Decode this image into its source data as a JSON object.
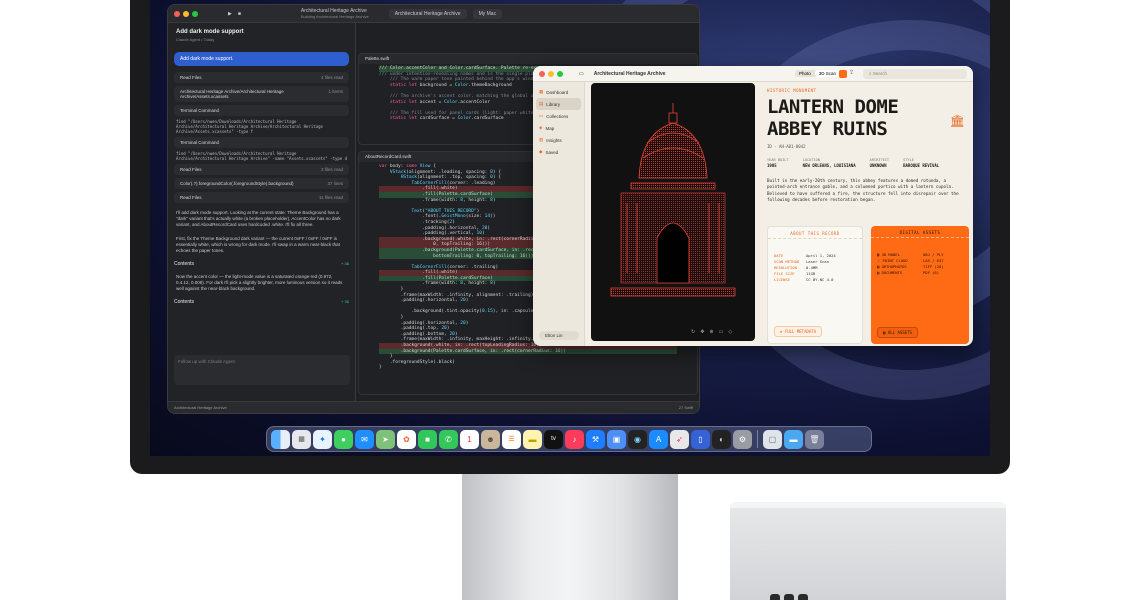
{
  "xcode": {
    "project": "Architectural Heritage Archive",
    "project_status": "Building Architectural Heritage Archive",
    "tab_file": "Architectural Heritage Archive",
    "tab_device": "My Mac",
    "chat_title": "Add dark mode support",
    "chat_sub": "Claude Agent • Today",
    "user_message": "Add dark mode support.",
    "cards": [
      {
        "label": "Read Files",
        "right": "4 files read"
      },
      {
        "label": "Architectural Heritage Archive/Architectural Heritage Archive/Assets.xcassets",
        "right": "1 items"
      },
      {
        "label": "Terminal Command",
        "right": ""
      },
      {
        "label": "Terminal Command",
        "right": ""
      },
      {
        "label": "Read Files",
        "right": "3 files read"
      },
      {
        "label": "Color(.?).foregroundColor(.foregroundStyle(.background)",
        "right": "37 lines"
      },
      {
        "label": "Read Files",
        "right": "11 files read"
      }
    ],
    "cmd1": "find \"/Users/nwen/Downloads/Architectural Heritage Archive/Architectural Heritage Archive/Architectural Heritage Archive/Assets.xcassets\" -type f",
    "cmd2": "find \"/Users/nwen/Downloads/Architectural Heritage Archive/Architectural Heritage Archive\" -name \"Assets.xcassets\" -type d",
    "cmd3": "find \"/Users/nwen/Downloads/Architectural Heritage Archive/Architectural Heritage Archive/Assets.xcassets\" -type f | head -20",
    "para1": "I'll add dark mode support. Looking at the current state: Theme Background has a \"dark\" variant that's actually white (a broken placeholder), AccentColor has no dark variant, and AboutRecordCard uses hardcoded .white. I'll fix all three.",
    "para2": "First, fix the Theme Background dark variant — the current 0xFF / 0xFF / 0xFF is essentially white, which is wrong for dark mode. I'll swap in a warm near-black that echoes the paper tones.",
    "chip1": "Contents",
    "chip1_tag": "+ 36",
    "para3": "Now the accent color — the light-mode value is a saturated orange-red (0.972, 0.4.12, 0.008). For dark I'll pick a slightly brighter, more luminous version so it reads well against the near-black background.",
    "chip2": "Contents",
    "chip2_tag": "+ 36",
    "input_placeholder": "Follow up with Claude Agent",
    "file1": "Palette.swift",
    "file2": "AboutRecordCard.swift",
    "status": "Architectural Heritage Archive",
    "status_right": "27 Swift"
  },
  "archive": {
    "window_title": "Architectural Heritage Archive",
    "seg_photo": "Photo",
    "seg_scan": "3D Scan",
    "search_placeholder": "Search",
    "nav": [
      {
        "label": "Dashboard",
        "icon": "grid-icon"
      },
      {
        "label": "Library",
        "icon": "book-icon"
      },
      {
        "label": "Collections",
        "icon": "folder-icon"
      },
      {
        "label": "Map",
        "icon": "map-icon"
      },
      {
        "label": "Insights",
        "icon": "chart-icon"
      },
      {
        "label": "Saved",
        "icon": "bookmark-icon"
      }
    ],
    "user": "Elton Lin",
    "eyebrow": "HISTORIC MONUMENT",
    "title_line1": "LANTERN DOME",
    "title_line2": "ABBEY RUINS",
    "record_id": "ID · AH-A01-0042",
    "meta": [
      {
        "k": "YEAR BUILT",
        "v": "1905"
      },
      {
        "k": "LOCATION",
        "v": "NEW ORLEANS, LOUISIANA"
      },
      {
        "k": "ARCHITECT",
        "v": "UNKNOWN"
      },
      {
        "k": "STYLE",
        "v": "BAROQUE REVIVAL"
      }
    ],
    "description": "Built in the early-20th century, this abbey features a domed rotunda, a pointed-arch entrance gable, and a columned portico with a lantern cupola. Believed to have suffered a fire, the structure fell into disrepair over the following decades before restoration began.",
    "about_title": "ABOUT THIS RECORD",
    "about_rows": [
      {
        "k": "DATE",
        "v": "April 1, 2024"
      },
      {
        "k": "SCAN METHOD",
        "v": "Laser Scan"
      },
      {
        "k": "RESOLUTION",
        "v": "0.4MM"
      },
      {
        "k": "FILE SIZE",
        "v": "11GB"
      },
      {
        "k": "LICENSE",
        "v": "CC BY-NC 4.0"
      }
    ],
    "about_button": "FULL METADATA",
    "assets_title": "DIGITAL ASSETS",
    "assets_rows": [
      {
        "k": "3D MODEL",
        "v": "OBJ / PLY"
      },
      {
        "k": "POINT CLOUD",
        "v": "LAS / E57"
      },
      {
        "k": "ORTHOPHOTOS",
        "v": "TIFF (28)"
      },
      {
        "k": "DOCUMENTS",
        "v": "PDF (6)"
      }
    ],
    "assets_button": "ALL ASSETS"
  },
  "dock": [
    "finder-icon",
    "launchpad-icon",
    "safari-icon",
    "messages-icon",
    "mail-icon",
    "maps-icon",
    "photos-icon",
    "facetime-icon",
    "phone-icon",
    "calendar-icon",
    "contacts-icon",
    "reminders-icon",
    "notes-icon",
    "tv-icon",
    "music-icon",
    "xcode-icon",
    "preview-icon",
    "terminal-icon",
    "appstore-icon",
    "instruments-icon",
    "simulator-icon",
    "activity-icon",
    "settings-icon",
    "window-icon",
    "folder-icon",
    "trash-icon"
  ],
  "dock_calendar_day": "1",
  "dock_tv_label": "tv",
  "colors": {
    "accent": "#ff6a14",
    "paper": "#f3efe6",
    "editor": "#1f2023"
  }
}
